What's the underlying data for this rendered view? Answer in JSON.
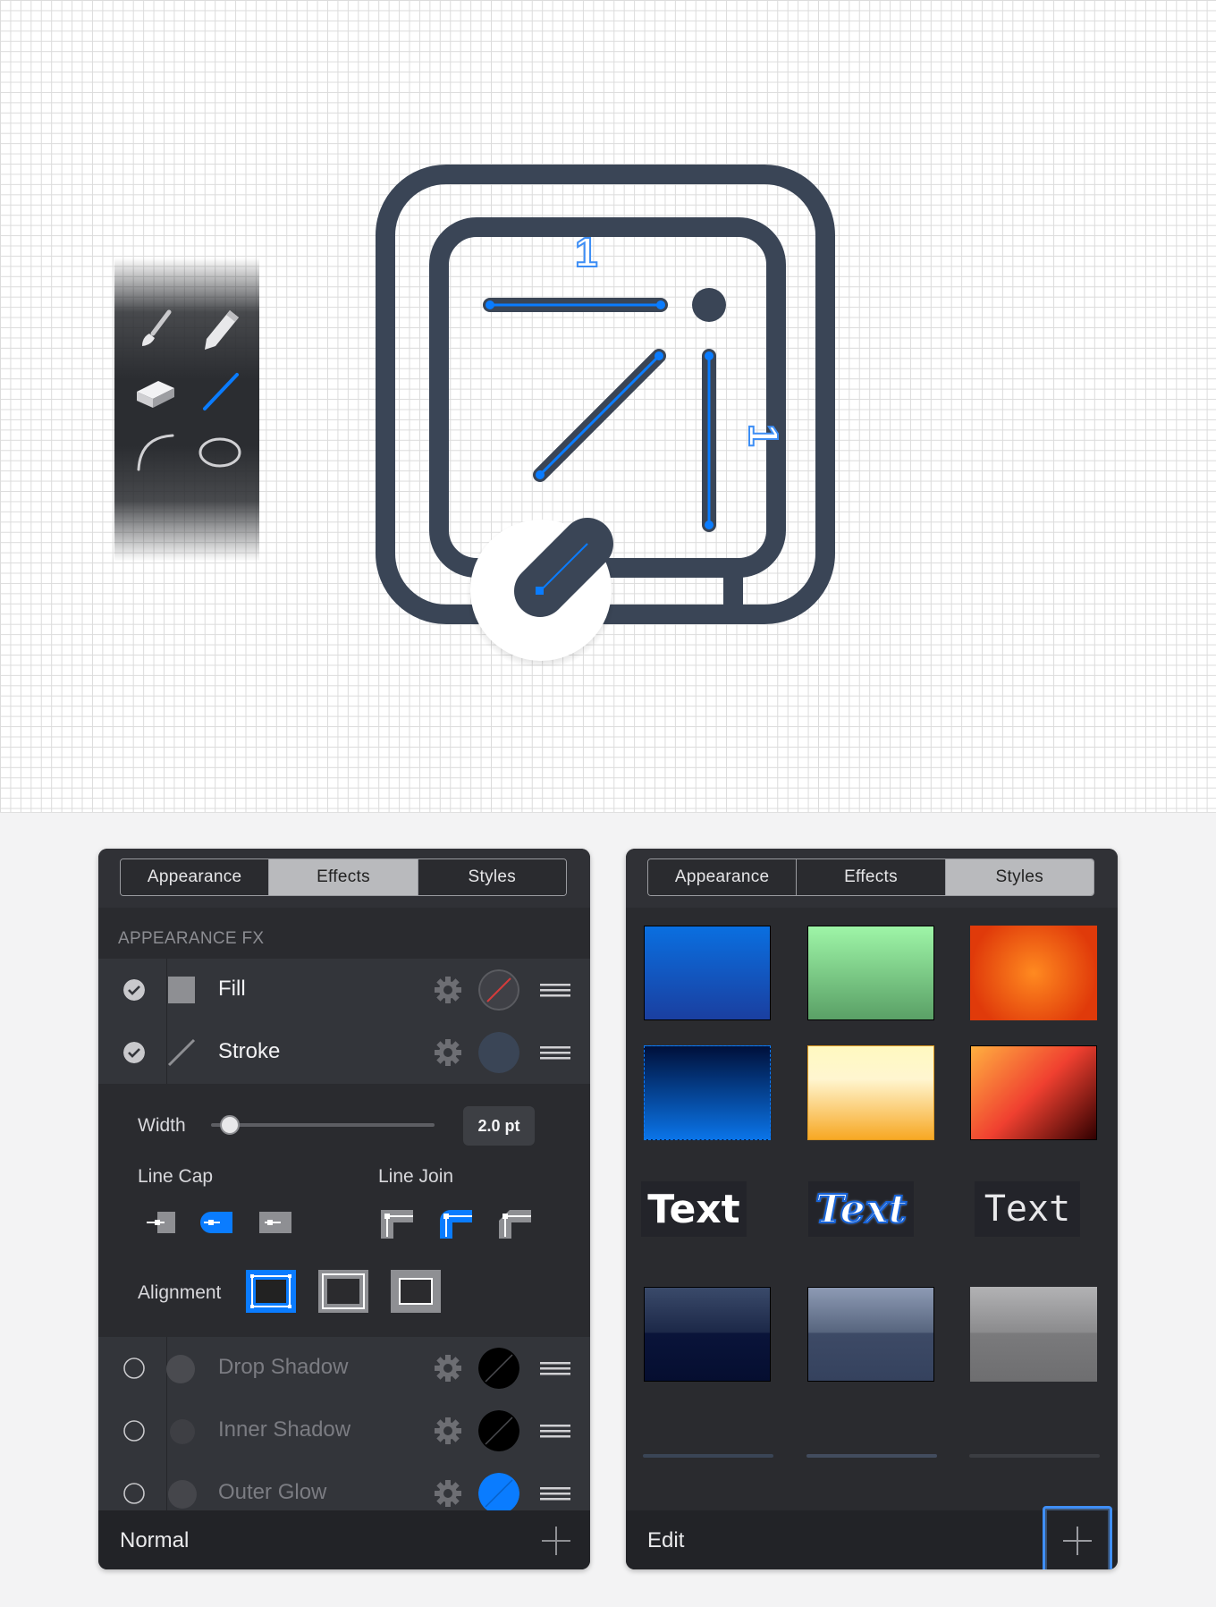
{
  "canvas": {
    "label_top": "1",
    "label_side": "1"
  },
  "tools": [
    {
      "name": "paintbrush-icon"
    },
    {
      "name": "pencil-icon"
    },
    {
      "name": "eraser-icon"
    },
    {
      "name": "line-tool-icon"
    },
    {
      "name": "arc-tool-icon"
    },
    {
      "name": "ellipse-tool-icon"
    }
  ],
  "left_panel": {
    "tabs": [
      "Appearance",
      "Effects",
      "Styles"
    ],
    "active_tab": "Effects",
    "section_title": "APPEARANCE FX",
    "fx": [
      {
        "label": "Fill",
        "enabled": true,
        "swatch": "none"
      },
      {
        "label": "Stroke",
        "enabled": true,
        "swatch": "#3a4556"
      },
      {
        "label": "Drop Shadow",
        "enabled": false,
        "swatch": "#000000"
      },
      {
        "label": "Inner Shadow",
        "enabled": false,
        "swatch": "#000000"
      },
      {
        "label": "Outer Glow",
        "enabled": false,
        "swatch": "#0a7cff"
      }
    ],
    "stroke": {
      "width_label": "Width",
      "width_value": "2.0 pt",
      "line_cap_label": "Line Cap",
      "line_join_label": "Line Join",
      "alignment_label": "Alignment",
      "selected_cap": "round",
      "selected_join": "round",
      "selected_alignment": "inside"
    },
    "footer_label": "Normal"
  },
  "right_panel": {
    "tabs": [
      "Appearance",
      "Effects",
      "Styles"
    ],
    "active_tab": "Styles",
    "text_samples": [
      "Text",
      "Text",
      "Text"
    ],
    "footer_label": "Edit"
  },
  "colors": {
    "accent": "#0a7cff",
    "icon_stroke": "#3a4556",
    "panel_bg": "#2a2b2f"
  }
}
